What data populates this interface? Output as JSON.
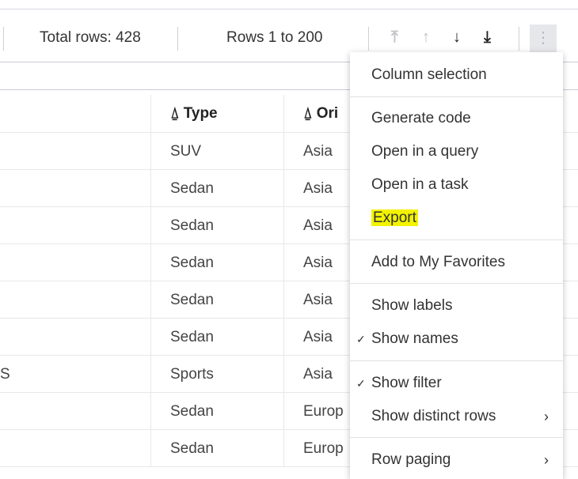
{
  "toolbar": {
    "total_rows": "Total rows: 428",
    "rows_range": "Rows 1 to 200",
    "first": "⤒",
    "prev": "↑",
    "next": "↓",
    "last": "⤓",
    "more": "⋮"
  },
  "columns": [
    {
      "label": ""
    },
    {
      "label": "Type"
    },
    {
      "label": "Ori"
    }
  ],
  "rows": [
    [
      "",
      "SUV",
      "Asia"
    ],
    [
      "",
      "Sedan",
      "Asia"
    ],
    [
      "",
      "Sedan",
      "Asia"
    ],
    [
      "",
      "Sedan",
      "Asia"
    ],
    [
      "",
      "Sedan",
      "Asia"
    ],
    [
      "",
      "Sedan",
      "Asia"
    ],
    [
      "S",
      "Sports",
      "Asia"
    ],
    [
      "",
      "Sedan",
      "Europ"
    ],
    [
      "",
      "Sedan",
      "Europ"
    ]
  ],
  "menu": {
    "items": [
      "Column selection",
      "Generate code",
      "Open in a query",
      "Open in a task",
      "Export",
      "Add to My Favorites",
      "Show labels",
      "Show names",
      "Show filter",
      "Show distinct rows",
      "Row paging"
    ],
    "check": "✓",
    "chevron": "›"
  }
}
